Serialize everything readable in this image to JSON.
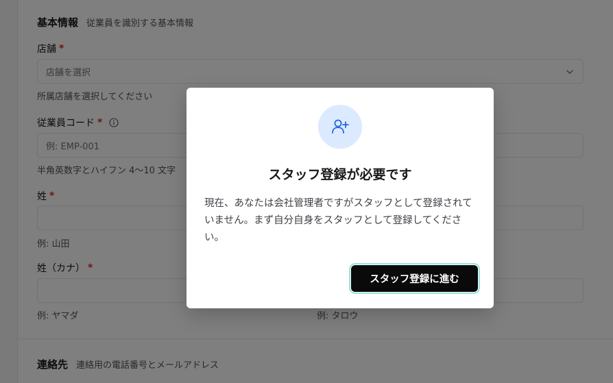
{
  "basic_section": {
    "title": "基本情報",
    "description": "従業員を識別する基本情報"
  },
  "store_field": {
    "label": "店舗",
    "required": "*",
    "placeholder": "店舗を選択",
    "hint": "所属店舗を選択してください"
  },
  "employee_code_field": {
    "label": "従業員コード",
    "required": "*",
    "placeholder": "例: EMP-001",
    "hint": "半角英数字とハイフン 4〜10 文字"
  },
  "last_name_field": {
    "label": "姓",
    "required": "*",
    "value": "",
    "hint": "例: 山田"
  },
  "last_name_kana_field": {
    "label": "姓（カナ）",
    "required": "*",
    "value": "",
    "hint": "例: ヤマダ"
  },
  "first_name_kana_field": {
    "value": "",
    "hint": "例: タロウ"
  },
  "contact_section": {
    "title": "連絡先",
    "description": "連絡用の電話番号とメールアドレス"
  },
  "dialog": {
    "icon": "user-plus-icon",
    "title": "スタッフ登録が必要です",
    "body": "現在、あなたは会社管理者ですがスタッフとして登録されていません。まず自分自身をスタッフとして登録してください。",
    "button_label": "スタッフ登録に進む"
  },
  "colors": {
    "accent": "#2563eb",
    "required": "#dc2626",
    "button_bg": "#0a0a0a",
    "icon_bg": "#dbeafe"
  }
}
